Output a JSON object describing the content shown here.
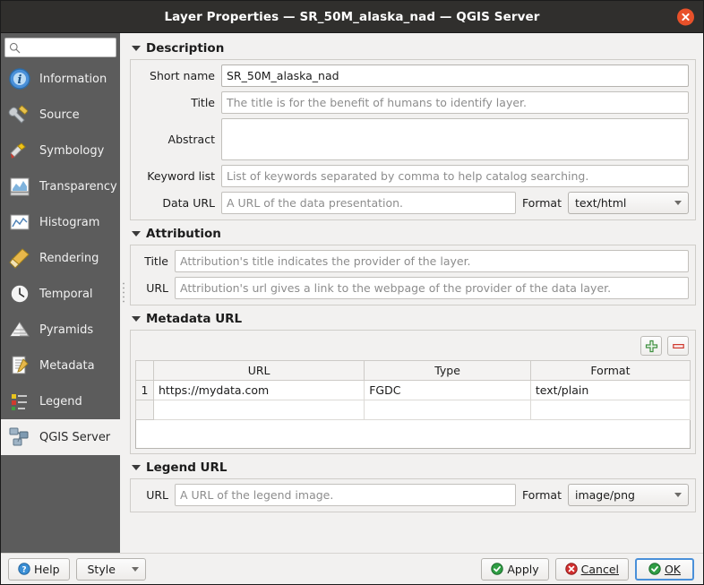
{
  "window": {
    "title": "Layer Properties — SR_50M_alaska_nad — QGIS Server",
    "close_icon": "close-icon"
  },
  "sidebar": {
    "search": {
      "value": "",
      "placeholder": "",
      "icon": "search-icon"
    },
    "items": [
      {
        "label": "Information",
        "icon": "information-icon",
        "selected": false
      },
      {
        "label": "Source",
        "icon": "source-icon",
        "selected": false
      },
      {
        "label": "Symbology",
        "icon": "symbology-icon",
        "selected": false
      },
      {
        "label": "Transparency",
        "icon": "transparency-icon",
        "selected": false
      },
      {
        "label": "Histogram",
        "icon": "histogram-icon",
        "selected": false
      },
      {
        "label": "Rendering",
        "icon": "rendering-icon",
        "selected": false
      },
      {
        "label": "Temporal",
        "icon": "temporal-icon",
        "selected": false
      },
      {
        "label": "Pyramids",
        "icon": "pyramids-icon",
        "selected": false
      },
      {
        "label": "Metadata",
        "icon": "metadata-icon",
        "selected": false
      },
      {
        "label": "Legend",
        "icon": "legend-icon",
        "selected": false
      },
      {
        "label": "QGIS Server",
        "icon": "qgis-server-icon",
        "selected": true
      }
    ]
  },
  "description": {
    "header": "Description",
    "short_name_label": "Short name",
    "short_name_value": "SR_50M_alaska_nad",
    "title_label": "Title",
    "title_placeholder": "The title is for the benefit of humans to identify layer.",
    "title_value": "",
    "abstract_label": "Abstract",
    "abstract_value": "",
    "keyword_label": "Keyword list",
    "keyword_placeholder": "List of keywords separated by comma to help catalog searching.",
    "keyword_value": "",
    "data_url_label": "Data URL",
    "data_url_placeholder": "A URL of the data presentation.",
    "data_url_value": "",
    "format_label": "Format",
    "format_value": "text/html"
  },
  "attribution": {
    "header": "Attribution",
    "title_label": "Title",
    "title_placeholder": "Attribution's title indicates the provider of the layer.",
    "title_value": "",
    "url_label": "URL",
    "url_placeholder": "Attribution's url gives a link to the webpage of the provider of the data layer.",
    "url_value": ""
  },
  "metadata_url": {
    "header": "Metadata URL",
    "add_icon": "add-icon",
    "remove_icon": "remove-icon",
    "columns": [
      "URL",
      "Type",
      "Format"
    ],
    "rows": [
      {
        "index": "1",
        "url": "https://mydata.com",
        "type": "FGDC",
        "format": "text/plain"
      }
    ]
  },
  "legend_url": {
    "header": "Legend URL",
    "url_label": "URL",
    "url_placeholder": "A URL of the legend image.",
    "url_value": "",
    "format_label": "Format",
    "format_value": "image/png"
  },
  "footer": {
    "help_label": "Help",
    "style_label": "Style",
    "apply_label": "Apply",
    "cancel_label": "Cancel",
    "ok_label": "OK"
  },
  "colors": {
    "titlebar": "#302f2d",
    "sidebar": "#5c5c5c",
    "close": "#e8512a",
    "accent_focus": "#4a90d9",
    "ok_green": "#2f9e44",
    "cancel_red": "#d32f2f",
    "help_blue": "#3a8fd6"
  }
}
